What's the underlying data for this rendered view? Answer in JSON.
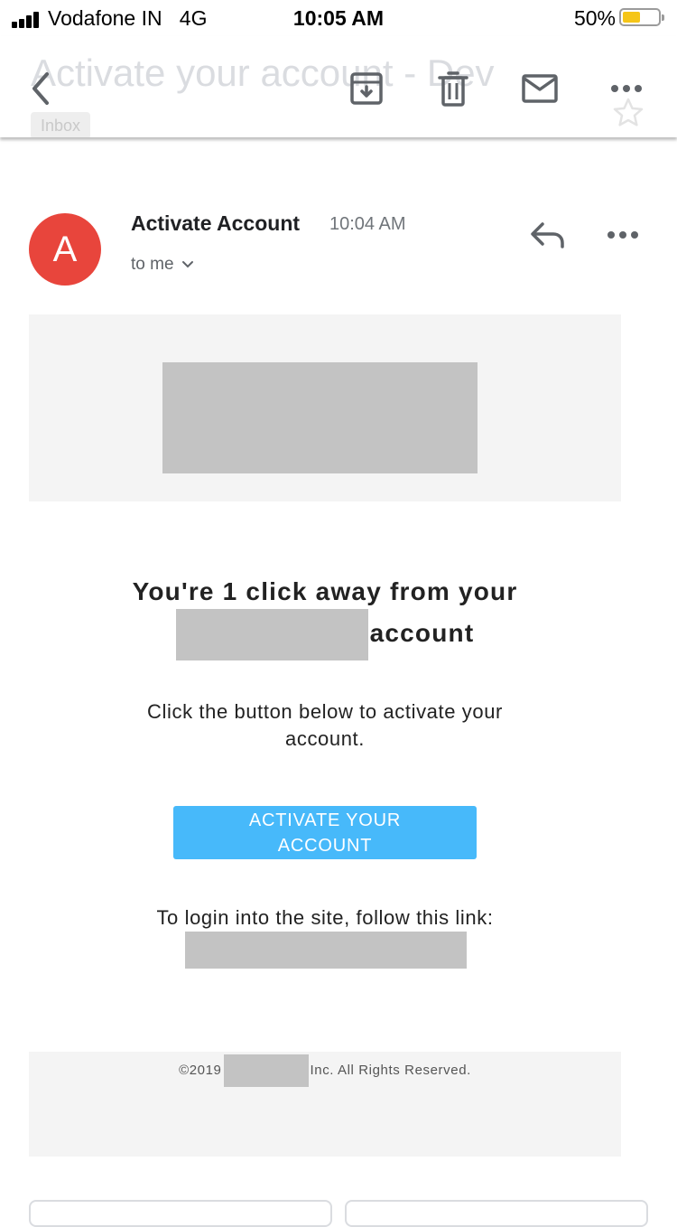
{
  "status_bar": {
    "carrier": "Vodafone IN",
    "network": "4G",
    "time": "10:05 AM",
    "battery_percent": "50%",
    "battery_level": 0.5,
    "battery_color": "#f5c518"
  },
  "toolbar": {
    "back_icon": "chevron-left-icon",
    "archive_icon": "archive-icon",
    "delete_icon": "trash-icon",
    "mark_unread_icon": "mail-icon",
    "more_icon": "more-horizontal-icon",
    "subject": "Activate your account - Dev",
    "label": "Inbox"
  },
  "message": {
    "avatar_letter": "A",
    "avatar_color": "#e8453c",
    "sender": "Activate Account",
    "time": "10:04 AM",
    "recipient": "to me",
    "reply_icon": "reply-icon",
    "more_icon": "more-horizontal-icon"
  },
  "email": {
    "headline_line1": "You're 1 click away from your",
    "headline_line2_suffix": "account",
    "intro": "Click the button below to activate your account.",
    "cta_label": "ACTIVATE YOUR ACCOUNT",
    "cta_color": "#47b9fa",
    "login_text": "To login into the site, follow this link:",
    "footer_prefix": "©2019",
    "footer_suffix": "Inc. All Rights Reserved."
  }
}
